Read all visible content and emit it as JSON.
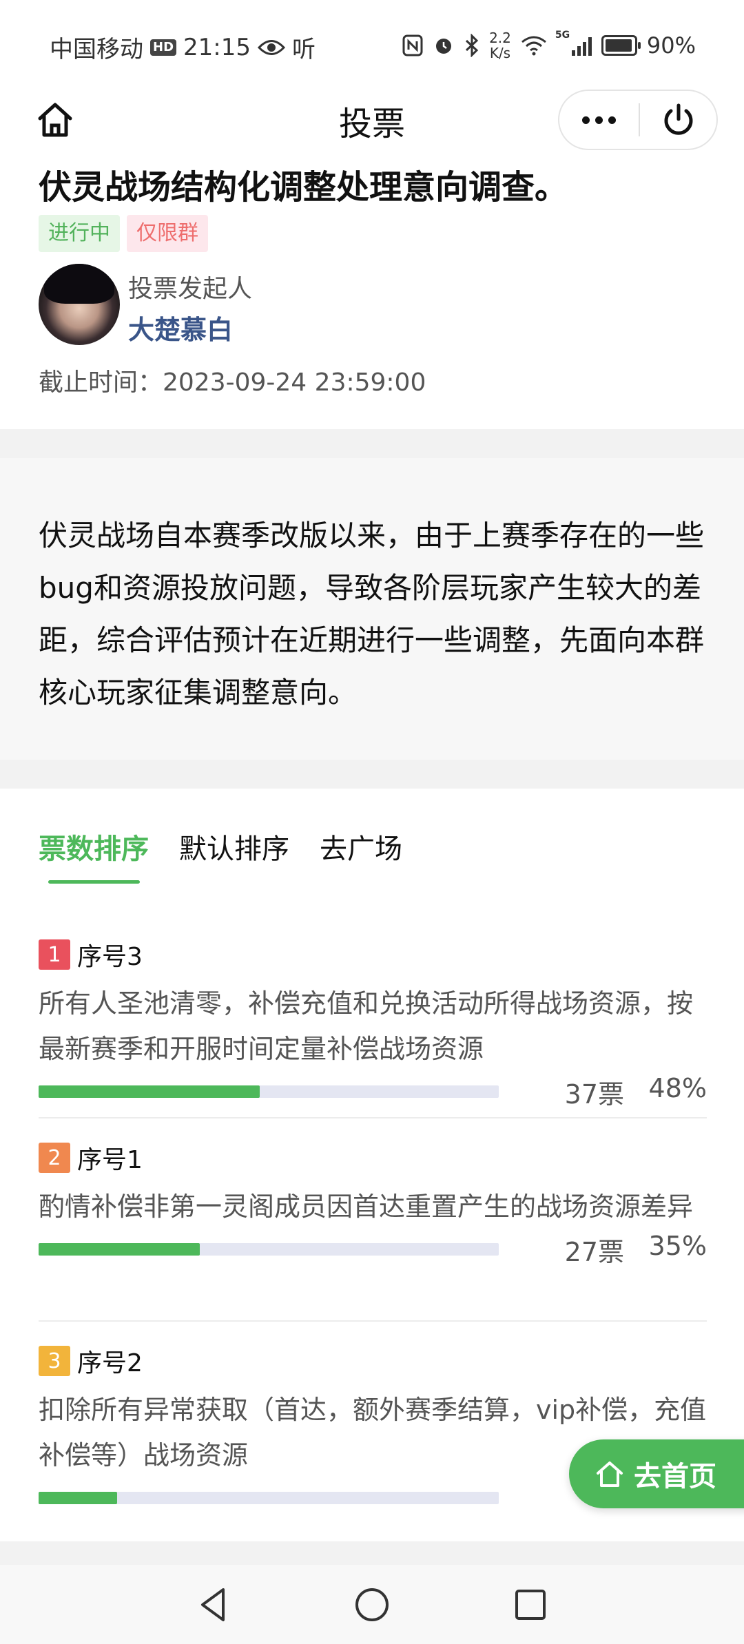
{
  "status_bar": {
    "carrier": "中国移动",
    "hd": "HD",
    "time": "21:15",
    "listen": "听",
    "speed_value": "2.2",
    "speed_unit": "K/s",
    "network": "5G",
    "battery": "90%"
  },
  "nav": {
    "title": "投票"
  },
  "vote": {
    "title": "伏灵战场结构化调整处理意向调查。",
    "tags": [
      "进行中",
      "仅限群"
    ],
    "initiator_label": "投票发起人",
    "initiator_name": "大楚慕白",
    "deadline": "截止时间：2023-09-24 23:59:00",
    "description": "伏灵战场自本赛季改版以来，由于上赛季存在的一些bug和资源投放问题，导致各阶层玩家产生较大的差距，综合评估预计在近期进行一些调整，先面向本群核心玩家征集调整意向。"
  },
  "tabs": [
    "票数排序",
    "默认排序",
    "去广场"
  ],
  "options": [
    {
      "rank": "1",
      "label": "序号3",
      "text": "所有人圣池清零，补偿充值和兑换活动所得战场资源，按最新赛季和开服时间定量补偿战场资源",
      "votes": "37票",
      "percent": "48%",
      "fraction": 0.48
    },
    {
      "rank": "2",
      "label": "序号1",
      "text": "酌情补偿非第一灵阁成员因首达重置产生的战场资源差异",
      "votes": "27票",
      "percent": "35%",
      "fraction": 0.35
    },
    {
      "rank": "3",
      "label": "序号2",
      "text": "扣除所有异常获取（首达，额外赛季结算，vip补偿，充值补偿等）战场资源",
      "votes": "",
      "percent": "",
      "fraction": 0.17
    }
  ],
  "float_button": {
    "label": "去首页",
    "icon": "home-icon"
  },
  "colors": {
    "accent": "#4db85a",
    "rank1": "#e9515d",
    "rank2": "#f0884f",
    "rank3": "#f2b43b",
    "initiator": "#3a5589"
  }
}
